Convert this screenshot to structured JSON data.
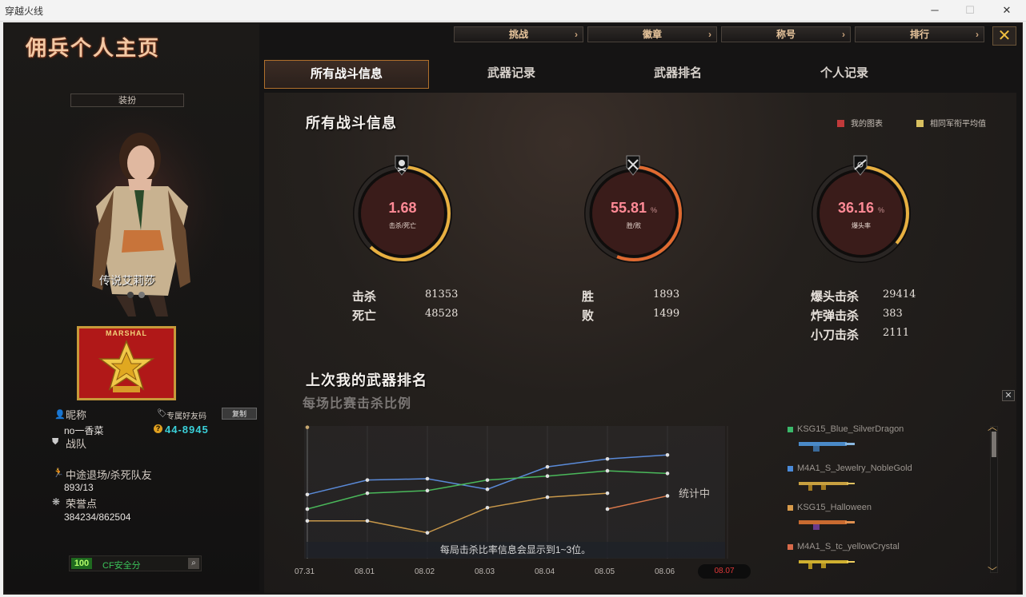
{
  "window": {
    "title": "穿越火线",
    "minimize": "─",
    "maximize": "☐",
    "close": "✕"
  },
  "page_title": "佣兵个人主页",
  "topnav": [
    {
      "label": "挑战"
    },
    {
      "label": "徽章"
    },
    {
      "label": "称号"
    },
    {
      "label": "排行"
    }
  ],
  "tabs": [
    {
      "label": "所有战斗信息",
      "active": true
    },
    {
      "label": "武器记录"
    },
    {
      "label": "武器排名"
    },
    {
      "label": "个人记录"
    }
  ],
  "left": {
    "outfit_button": "装扮",
    "character_name": "传说艾莉莎",
    "rank_text": "MARSHAL",
    "nickname_label": "昵称",
    "nickname": "no一香菜",
    "friend_code_label": "专属好友码",
    "copy_button": "复制",
    "friend_code": "44-8945",
    "team_label": "战队",
    "quit_label": "中途退场/杀死队友",
    "quit_value": "893/13",
    "honor_label": "荣誉点",
    "honor_value": "384234/862504",
    "safety_score": "100",
    "safety_label": "CF安全分"
  },
  "battle": {
    "title": "所有战斗信息",
    "legend_mine": "我的图表",
    "legend_avg": "相同军衔平均值",
    "legend_colors": {
      "mine": "#c03a3a",
      "avg": "#d8c060"
    },
    "gauges": [
      {
        "value": "1.68",
        "unit": "",
        "caption": "击杀/死亡",
        "icon": "skull-crossbones-icon",
        "fraction": 0.62
      },
      {
        "value": "55.81",
        "unit": "%",
        "caption": "胜/败",
        "icon": "crossed-swords-icon",
        "fraction": 0.5581
      },
      {
        "value": "36.16",
        "unit": "%",
        "caption": "爆头率",
        "icon": "crosshair-rifle-icon",
        "fraction": 0.3616
      }
    ],
    "stats": {
      "kills_label": "击杀",
      "kills": "81353",
      "deaths_label": "死亡",
      "deaths": "48528",
      "wins_label": "胜",
      "wins": "1893",
      "losses_label": "败",
      "losses": "1499",
      "headshot_label": "爆头击杀",
      "headshot": "29414",
      "bomb_label": "炸弹击杀",
      "bomb": "383",
      "knife_label": "小刀击杀",
      "knife": "2111"
    }
  },
  "weapon_rank": {
    "title": "上次我的武器排名",
    "subtitle": "每场比赛击杀比例",
    "note": "每局击杀比率信息会显示到1~3位。",
    "status": "统计中",
    "close": "✕",
    "weapons": [
      {
        "name": "KSG15_Blue_SilverDragon",
        "color": "#3ab86a"
      },
      {
        "name": "M4A1_S_Jewelry_NobleGold",
        "color": "#4a8ad8"
      },
      {
        "name": "KSG15_Halloween",
        "color": "#d89a4a"
      },
      {
        "name": "M4A1_S_tc_yellowCrystal",
        "color": "#d86a4a"
      }
    ]
  },
  "chart_data": {
    "type": "line",
    "categories": [
      "07.31",
      "08.01",
      "08.02",
      "08.03",
      "08.04",
      "08.05",
      "08.06",
      "08.07"
    ],
    "selected_category": "08.07",
    "ylim": [
      0,
      1
    ],
    "series": [
      {
        "color": "#5a8ad8",
        "values": [
          0.48,
          0.59,
          0.6,
          0.52,
          0.69,
          0.75,
          0.78,
          null
        ]
      },
      {
        "color": "#4ab85a",
        "values": [
          0.37,
          0.49,
          0.51,
          0.59,
          0.62,
          0.66,
          0.64,
          null
        ]
      },
      {
        "color": "#c8984a",
        "values": [
          0.28,
          0.28,
          0.19,
          0.38,
          0.46,
          0.49,
          null,
          null
        ]
      },
      {
        "color": "#d8784a",
        "values": [
          null,
          null,
          null,
          null,
          null,
          0.37,
          0.47,
          null
        ]
      }
    ],
    "extra_points": [
      {
        "x": "07.31",
        "y": 0.99,
        "color": "#c8a870"
      }
    ]
  }
}
